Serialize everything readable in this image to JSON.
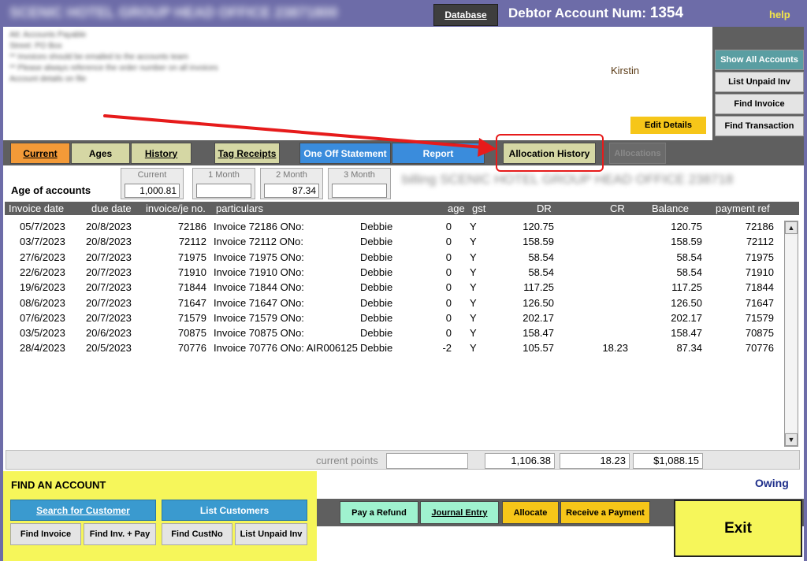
{
  "header": {
    "title": "SCENIC HOTEL GROUP HEAD OFFICE 23871800",
    "database_label": "Database",
    "account_label": "Debtor Account Num:",
    "account_number": "1354",
    "help_label": "help"
  },
  "customer": {
    "address_lines": [
      "Att: Accounts Payable",
      "Street: PO Box",
      "** Invoices should be emailed to the accounts team",
      "** Please always reference the order number on all invoices",
      "Account details on file"
    ],
    "contact": "Kirstin",
    "edit_details_label": "Edit Details",
    "billing_name": "billing SCENIC HOTEL GROUP HEAD OFFICE 23871800"
  },
  "side_buttons": {
    "show_all": "Show All Accounts",
    "list_unpaid": "List Unpaid Inv",
    "find_invoice": "Find Invoice",
    "find_transaction": "Find Transaction"
  },
  "tabs": {
    "current": "Current",
    "ages": "Ages",
    "history": "History",
    "tag_receipts": "Tag Receipts",
    "one_off_statement": "One Off Statement",
    "report": "Report",
    "allocation_history": "Allocation History",
    "allocations": "Allocations"
  },
  "ages": {
    "title": "Age of accounts",
    "current": {
      "label": "Current",
      "value": "1,000.81"
    },
    "month1": {
      "label": "1 Month",
      "value": ""
    },
    "month2": {
      "label": "2 Month",
      "value": "87.34"
    },
    "month3": {
      "label": "3 Month",
      "value": ""
    }
  },
  "table": {
    "headers": {
      "date": "Invoice date",
      "due": "due date",
      "inv": "invoice/je no.",
      "particulars": "particulars",
      "age": "age",
      "gst": "gst",
      "dr": "DR",
      "cr": "CR",
      "balance": "Balance",
      "ref": "payment ref"
    },
    "rows": [
      {
        "date": "05/7/2023",
        "due": "20/8/2023",
        "inv": "72186",
        "part": "Invoice 72186 ONo:",
        "staff": "Debbie",
        "age": "0",
        "gst": "Y",
        "dr": "120.75",
        "cr": "",
        "bal": "120.75",
        "ref": "72186"
      },
      {
        "date": "03/7/2023",
        "due": "20/8/2023",
        "inv": "72112",
        "part": "Invoice 72112 ONo:",
        "staff": "Debbie",
        "age": "0",
        "gst": "Y",
        "dr": "158.59",
        "cr": "",
        "bal": "158.59",
        "ref": "72112"
      },
      {
        "date": "27/6/2023",
        "due": "20/7/2023",
        "inv": "71975",
        "part": "Invoice 71975 ONo:",
        "staff": "Debbie",
        "age": "0",
        "gst": "Y",
        "dr": "58.54",
        "cr": "",
        "bal": "58.54",
        "ref": "71975"
      },
      {
        "date": "22/6/2023",
        "due": "20/7/2023",
        "inv": "71910",
        "part": "Invoice 71910 ONo:",
        "staff": "Debbie",
        "age": "0",
        "gst": "Y",
        "dr": "58.54",
        "cr": "",
        "bal": "58.54",
        "ref": "71910"
      },
      {
        "date": "19/6/2023",
        "due": "20/7/2023",
        "inv": "71844",
        "part": "Invoice 71844 ONo:",
        "staff": "Debbie",
        "age": "0",
        "gst": "Y",
        "dr": "117.25",
        "cr": "",
        "bal": "117.25",
        "ref": "71844"
      },
      {
        "date": "08/6/2023",
        "due": "20/7/2023",
        "inv": "71647",
        "part": "Invoice 71647 ONo:",
        "staff": "Debbie",
        "age": "0",
        "gst": "Y",
        "dr": "126.50",
        "cr": "",
        "bal": "126.50",
        "ref": "71647"
      },
      {
        "date": "07/6/2023",
        "due": "20/7/2023",
        "inv": "71579",
        "part": "Invoice 71579 ONo:",
        "staff": "Debbie",
        "age": "0",
        "gst": "Y",
        "dr": "202.17",
        "cr": "",
        "bal": "202.17",
        "ref": "71579"
      },
      {
        "date": "03/5/2023",
        "due": "20/6/2023",
        "inv": "70875",
        "part": "Invoice 70875 ONo:",
        "staff": "Debbie",
        "age": "0",
        "gst": "Y",
        "dr": "158.47",
        "cr": "",
        "bal": "158.47",
        "ref": "70875"
      },
      {
        "date": "28/4/2023",
        "due": "20/5/2023",
        "inv": "70776",
        "part": "Invoice 70776 ONo: AIR006125",
        "staff": "Debbie",
        "age": "-2",
        "gst": "Y",
        "dr": "105.57",
        "cr": "18.23",
        "bal": "87.34",
        "ref": "70776"
      }
    ]
  },
  "scrollbar": {
    "up": "▲",
    "down": "▼"
  },
  "totals": {
    "points_label": "current points",
    "points": "",
    "dr": "1,106.38",
    "cr": "18.23",
    "balance": "$1,088.15",
    "owing_label": "Owing"
  },
  "find": {
    "title": "FIND AN ACCOUNT",
    "search_customer": "Search for Customer",
    "list_customers": "List Customers",
    "find_invoice": "Find Invoice",
    "find_inv_pay": "Find Inv. + Pay",
    "find_custno": "Find CustNo",
    "list_unpaid": "List Unpaid Inv"
  },
  "actions": {
    "pay_refund": "Pay a Refund",
    "journal_entry": "Journal Entry",
    "allocate": "Allocate",
    "receive_payment": "Receive a Payment",
    "exit": "Exit"
  },
  "colors": {
    "title_bar": "#6d6ca8",
    "tab_active": "#f39a38",
    "tab_default": "#d5d7a4",
    "tab_blue": "#3a8cdc",
    "accent_yellow": "#f6f65a",
    "annotation": "#e61b1b"
  }
}
